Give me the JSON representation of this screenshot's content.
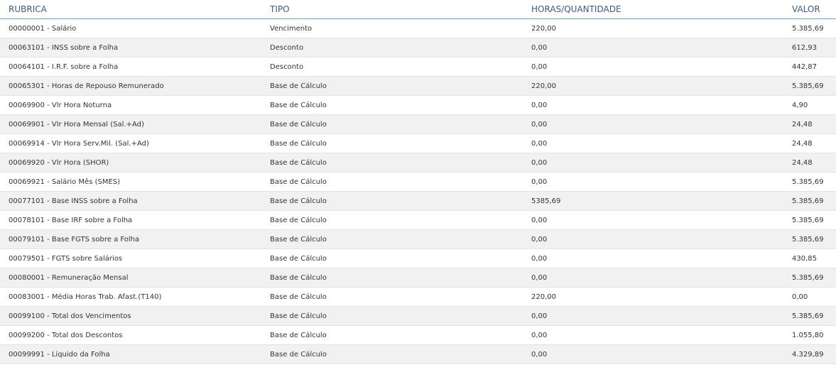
{
  "table": {
    "headers": {
      "rubrica": "RUBRICA",
      "tipo": "TIPO",
      "horas": "HORAS/QUANTIDADE",
      "valor": "VALOR"
    },
    "rows": [
      {
        "rubrica": "00000001 - Salário",
        "tipo": "Vencimento",
        "horas": "220,00",
        "valor": "5.385,69"
      },
      {
        "rubrica": "00063101 - INSS sobre a Folha",
        "tipo": "Desconto",
        "horas": "0,00",
        "valor": "612,93"
      },
      {
        "rubrica": "00064101 - I.R.F. sobre a Folha",
        "tipo": "Desconto",
        "horas": "0,00",
        "valor": "442,87"
      },
      {
        "rubrica": "00065301 - Horas de Repouso Remunerado",
        "tipo": "Base de Cálculo",
        "horas": "220,00",
        "valor": "5.385,69"
      },
      {
        "rubrica": "00069900 - Vlr Hora Noturna",
        "tipo": "Base de Cálculo",
        "horas": "0,00",
        "valor": "4,90"
      },
      {
        "rubrica": "00069901 - Vlr Hora Mensal (Sal.+Ad)",
        "tipo": "Base de Cálculo",
        "horas": "0,00",
        "valor": "24,48"
      },
      {
        "rubrica": "00069914 - Vlr Hora Serv.Mil. (Sal.+Ad)",
        "tipo": "Base de Cálculo",
        "horas": "0,00",
        "valor": "24,48"
      },
      {
        "rubrica": "00069920 - Vlr Hora (SHOR)",
        "tipo": "Base de Cálculo",
        "horas": "0,00",
        "valor": "24,48"
      },
      {
        "rubrica": "00069921 - Salário Mês (SMES)",
        "tipo": "Base de Cálculo",
        "horas": "0,00",
        "valor": "5.385,69"
      },
      {
        "rubrica": "00077101 - Base INSS sobre a Folha",
        "tipo": "Base de Cálculo",
        "horas": "5385,69",
        "valor": "5.385,69"
      },
      {
        "rubrica": "00078101 - Base IRF sobre a Folha",
        "tipo": "Base de Cálculo",
        "horas": "0,00",
        "valor": "5.385,69"
      },
      {
        "rubrica": "00079101 - Base FGTS sobre a Folha",
        "tipo": "Base de Cálculo",
        "horas": "0,00",
        "valor": "5.385,69"
      },
      {
        "rubrica": "00079501 - FGTS sobre Salários",
        "tipo": "Base de Cálculo",
        "horas": "0,00",
        "valor": "430,85"
      },
      {
        "rubrica": "00080001 - Remuneração Mensal",
        "tipo": "Base de Cálculo",
        "horas": "0,00",
        "valor": "5.385,69"
      },
      {
        "rubrica": "00083001 - Média Horas Trab. Afast.(T140)",
        "tipo": "Base de Cálculo",
        "horas": "220,00",
        "valor": "0,00"
      },
      {
        "rubrica": "00099100 - Total dos Vencimentos",
        "tipo": "Base de Cálculo",
        "horas": "0,00",
        "valor": "5.385,69"
      },
      {
        "rubrica": "00099200 - Total dos Descontos",
        "tipo": "Base de Cálculo",
        "horas": "0,00",
        "valor": "1.055,80"
      },
      {
        "rubrica": "00099991 - Líquido da Folha",
        "tipo": "Base de Cálculo",
        "horas": "0,00",
        "valor": "4.329,89"
      }
    ]
  }
}
